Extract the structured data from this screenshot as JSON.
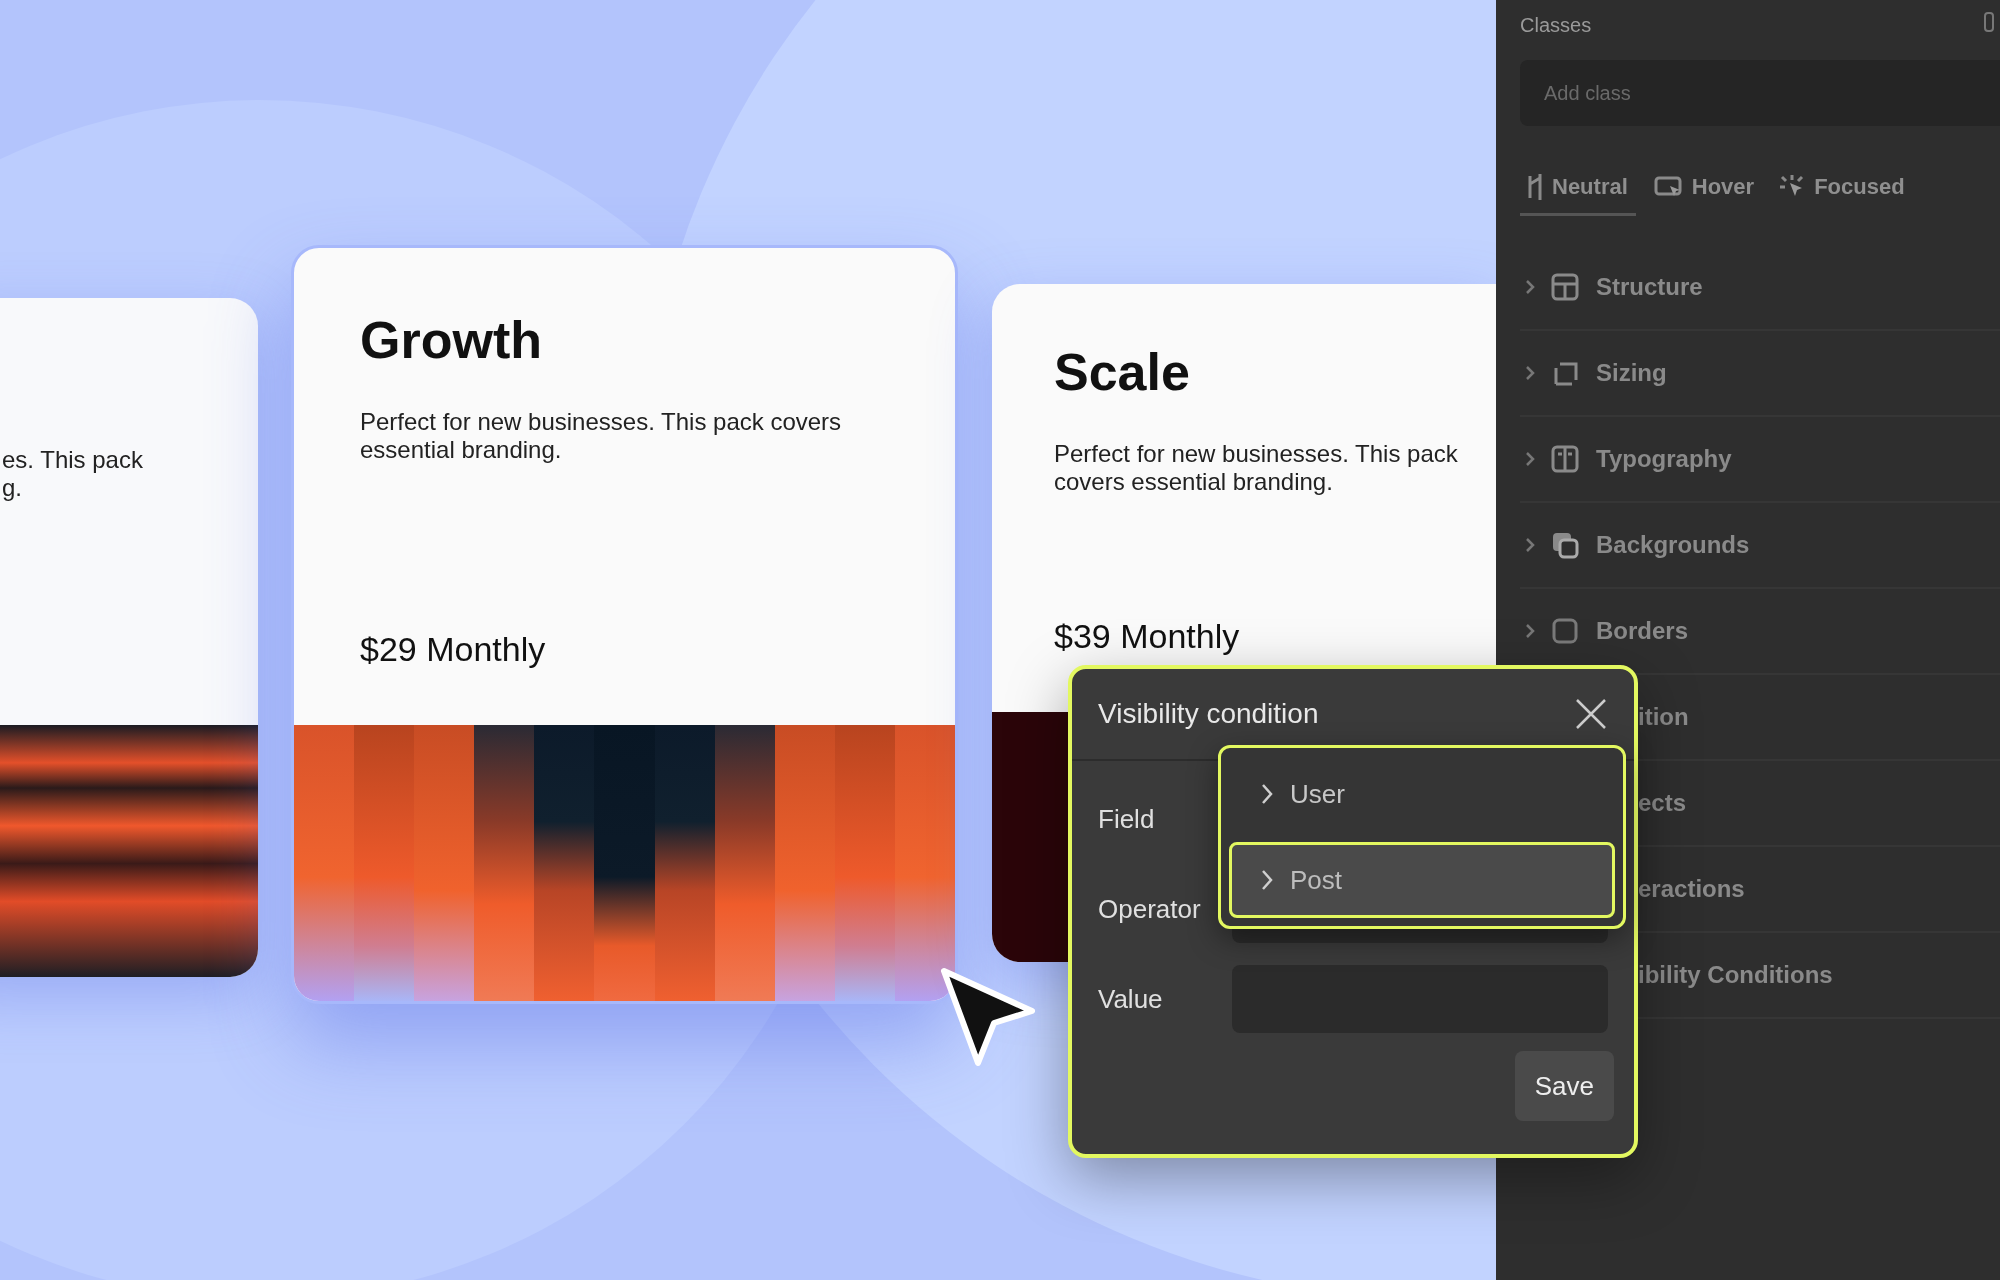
{
  "cards": [
    {
      "description_lines": [
        "es. This pack",
        "g."
      ]
    },
    {
      "title": "Growth",
      "description_lines": [
        "Perfect for new businesses. This pack covers",
        "essential branding."
      ],
      "price": "$29 Monthly"
    },
    {
      "title": "Scale",
      "description_lines": [
        "Perfect for new businesses. This pack",
        "covers essential branding."
      ],
      "price": "$39 Monthly"
    }
  ],
  "panel": {
    "title": "Classes",
    "class_field": {
      "placeholder": "Add class"
    },
    "state_tabs": [
      {
        "label": "Neutral",
        "selected": true
      },
      {
        "label": "Hover",
        "selected": false
      },
      {
        "label": "Focused",
        "selected": false
      }
    ],
    "sections": [
      {
        "label": "Structure",
        "kind": "full"
      },
      {
        "label": "Sizing",
        "kind": "full"
      },
      {
        "label": "Typography",
        "kind": "full"
      },
      {
        "label": "Backgrounds",
        "kind": "full"
      },
      {
        "label": "Borders",
        "kind": "full"
      },
      {
        "label": "ition",
        "kind": "covered"
      },
      {
        "label": "ects",
        "kind": "covered"
      },
      {
        "label": "eractions",
        "kind": "covered"
      },
      {
        "label": "ibility Conditions",
        "kind": "covered"
      }
    ]
  },
  "popup": {
    "title": "Visibility condition",
    "fields": [
      {
        "label": "Field"
      },
      {
        "label": "Operator"
      },
      {
        "label": "Value"
      }
    ],
    "dropdown": {
      "options": [
        {
          "label": "User",
          "selected": false
        },
        {
          "label": "Post",
          "selected": true
        }
      ]
    },
    "save_button": "Save"
  }
}
